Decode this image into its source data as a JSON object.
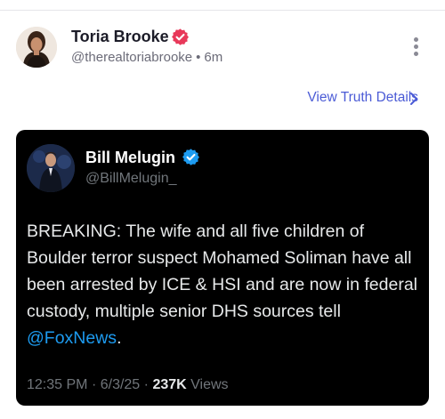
{
  "post": {
    "author_name": "Toria Brooke",
    "handle": "@therealtoriabrooke",
    "separator": "•",
    "time_ago": "6m",
    "view_details_label": "View Truth Details"
  },
  "embed": {
    "author_name": "Bill Melugin",
    "handle": "@BillMelugin_",
    "text": "BREAKING: The wife and all five children of Boulder terror suspect Mohamed Soliman have all been arrested by ICE & HSI and are now in federal custody, multiple senior DHS sources tell ",
    "mention": "@FoxNews",
    "text_end": ".",
    "time": "12:35 PM",
    "meta_sep": "·",
    "date": "6/3/25",
    "views_count": "237K",
    "views_label": "Views"
  },
  "colors": {
    "truth_verified": "#e8395a",
    "x_verified": "#1d9bf0",
    "link": "#4b5bd6"
  },
  "icons": [
    "verified-badge-icon",
    "more-vertical-icon",
    "chevron-right-icon"
  ]
}
